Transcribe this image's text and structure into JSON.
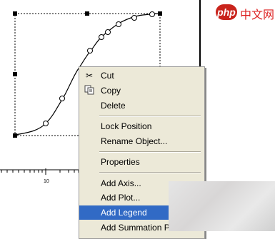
{
  "watermark": {
    "logo_p": "php",
    "logo_cn": "中文网"
  },
  "axis": {
    "tick_label": "10"
  },
  "context_menu": {
    "items": [
      {
        "label": "Cut",
        "icon": "scissors-icon"
      },
      {
        "label": "Copy",
        "icon": "copy-icon"
      },
      {
        "label": "Delete",
        "icon": ""
      },
      {
        "label": "Lock Position",
        "icon": ""
      },
      {
        "label": "Rename Object...",
        "icon": ""
      },
      {
        "label": "Properties",
        "icon": ""
      },
      {
        "label": "Add Axis...",
        "icon": ""
      },
      {
        "label": "Add Plot...",
        "icon": ""
      },
      {
        "label": "Add Legend",
        "icon": "",
        "highlighted": true
      },
      {
        "label": "Add Summation P",
        "icon": ""
      }
    ]
  },
  "colors": {
    "menu_bg": "#ece9d8",
    "highlight": "#316ac5"
  }
}
